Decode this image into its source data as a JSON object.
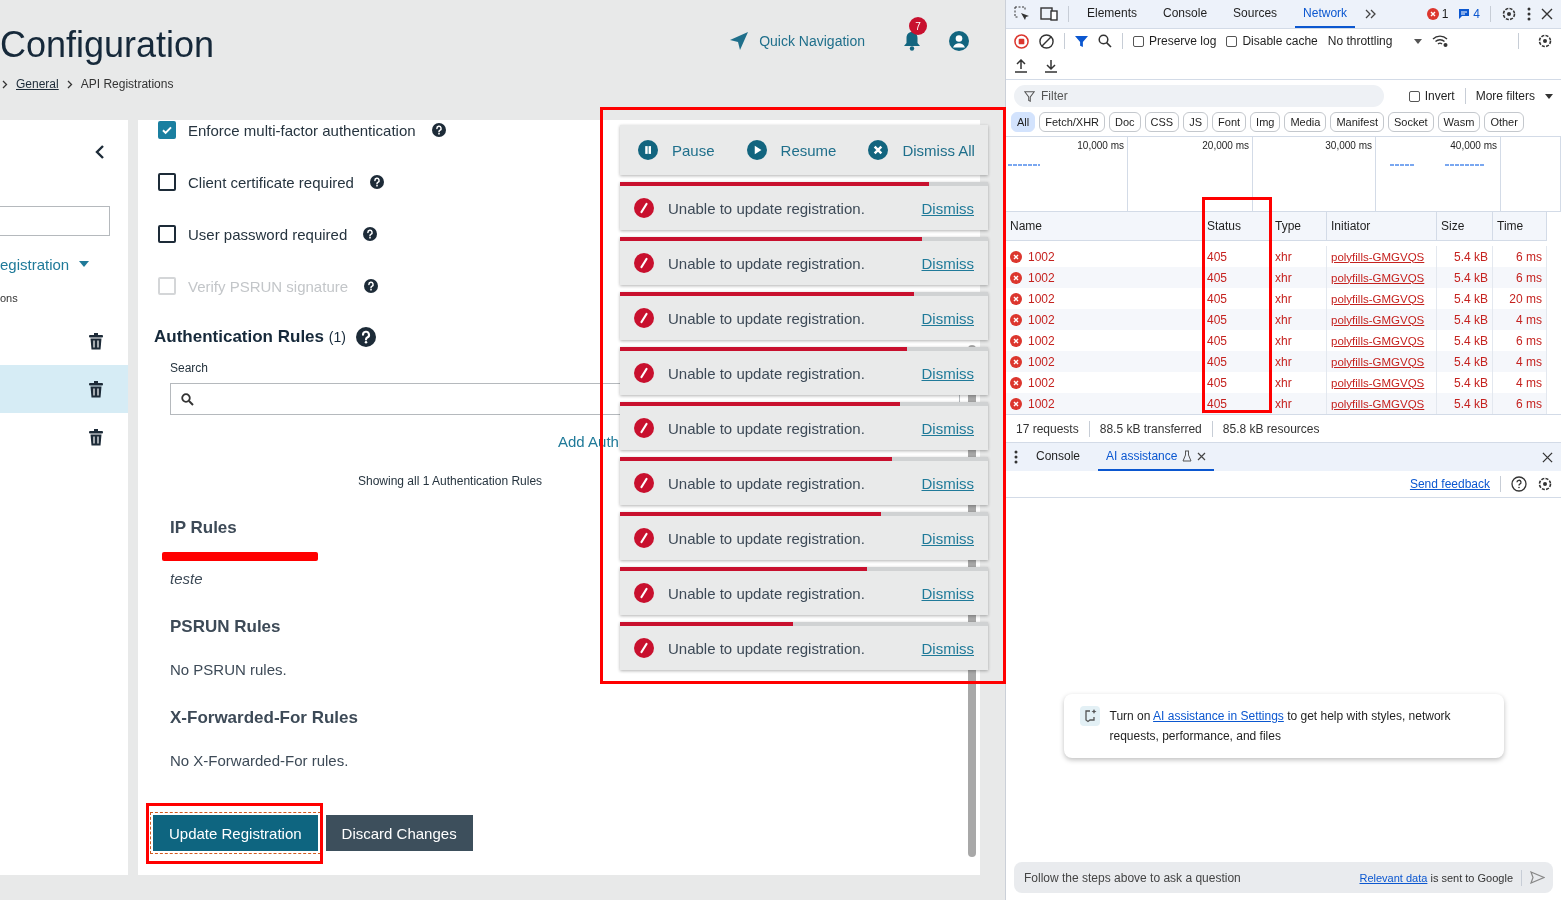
{
  "header": {
    "title": "Configuration",
    "breadcrumb": [
      {
        "label": "General",
        "link": true
      },
      {
        "label": "API Registrations",
        "link": false
      }
    ],
    "quick_nav": "Quick Navigation",
    "notifications": "7"
  },
  "sidebar": {
    "item_label": "egistration",
    "sub_label": "ons",
    "rows": [
      {
        "selected": false
      },
      {
        "selected": true
      },
      {
        "selected": false
      }
    ]
  },
  "form": {
    "options": [
      {
        "label": "Enforce multi-factor authentication",
        "checked": true,
        "disabled": false
      },
      {
        "label": "Client certificate required",
        "checked": false,
        "disabled": false
      },
      {
        "label": "User password required",
        "checked": false,
        "disabled": false
      },
      {
        "label": "Verify PSRUN signature",
        "checked": false,
        "disabled": true
      }
    ],
    "auth_rules": {
      "title": "Authentication Rules",
      "count": "(1)",
      "search_label": "Search",
      "add_link": "Add Auth",
      "showing": "Showing all 1 Authentication Rules"
    },
    "sections": [
      {
        "title": "IP Rules",
        "kind": "list",
        "items": [
          {
            "kind": "redacted"
          },
          {
            "kind": "text",
            "text": "teste"
          }
        ]
      },
      {
        "title": "PSRUN Rules",
        "kind": "empty",
        "text": "No PSRUN rules."
      },
      {
        "title": "X-Forwarded-For Rules",
        "kind": "empty",
        "text": "No X-Forwarded-For rules."
      }
    ],
    "buttons": [
      {
        "label": "Update Registration",
        "kind": "primary"
      },
      {
        "label": "Discard Changes",
        "kind": "secondary"
      }
    ]
  },
  "toasts": {
    "controls": [
      {
        "label": "Pause",
        "kind": "pause"
      },
      {
        "label": "Resume",
        "kind": "play"
      },
      {
        "label": "Dismiss All",
        "kind": "dismiss"
      }
    ],
    "items": [
      {
        "message": "Unable to update registration.",
        "action": "Dismiss",
        "level": 0.84
      },
      {
        "message": "Unable to update registration.",
        "action": "Dismiss",
        "level": 0.82
      },
      {
        "message": "Unable to update registration.",
        "action": "Dismiss",
        "level": 0.8
      },
      {
        "message": "Unable to update registration.",
        "action": "Dismiss",
        "level": 0.78
      },
      {
        "message": "Unable to update registration.",
        "action": "Dismiss",
        "level": 0.76
      },
      {
        "message": "Unable to update registration.",
        "action": "Dismiss",
        "level": 0.74
      },
      {
        "message": "Unable to update registration.",
        "action": "Dismiss",
        "level": 0.71
      },
      {
        "message": "Unable to update registration.",
        "action": "Dismiss",
        "level": 0.67
      },
      {
        "message": "Unable to update registration.",
        "action": "Dismiss",
        "level": 0.47
      }
    ]
  },
  "devtools": {
    "tabs": [
      {
        "label": "Elements",
        "selected": false
      },
      {
        "label": "Console",
        "selected": false
      },
      {
        "label": "Sources",
        "selected": false
      },
      {
        "label": "Network",
        "selected": true
      }
    ],
    "errors": "1",
    "messages": "4",
    "preserve_log": {
      "label": "Preserve log",
      "checked": false
    },
    "disable_cache": {
      "label": "Disable cache",
      "checked": false
    },
    "throttling": "No throttling",
    "filter": {
      "placeholder": "Filter"
    },
    "invert": {
      "label": "Invert",
      "checked": false
    },
    "more_filters": "More filters",
    "types": [
      {
        "label": "All",
        "selected": true
      },
      {
        "label": "Fetch/XHR",
        "selected": false
      },
      {
        "label": "Doc",
        "selected": false
      },
      {
        "label": "CSS",
        "selected": false
      },
      {
        "label": "JS",
        "selected": false
      },
      {
        "label": "Font",
        "selected": false
      },
      {
        "label": "Img",
        "selected": false
      },
      {
        "label": "Media",
        "selected": false
      },
      {
        "label": "Manifest",
        "selected": false
      },
      {
        "label": "Socket",
        "selected": false
      },
      {
        "label": "Wasm",
        "selected": false
      },
      {
        "label": "Other",
        "selected": false
      }
    ],
    "timeline": [
      "10,000 ms",
      "20,000 ms",
      "30,000 ms",
      "40,000 ms"
    ],
    "columns": [
      "Name",
      "Status",
      "Type",
      "Initiator",
      "Size",
      "Time"
    ],
    "rows": [
      {
        "name": "1002",
        "status": "405",
        "type": "xhr",
        "initiator": "polyfills-GMGVQS",
        "size": "5.4 kB",
        "time": "6 ms",
        "failed": true
      },
      {
        "name": "1002",
        "status": "405",
        "type": "xhr",
        "initiator": "polyfills-GMGVQS",
        "size": "5.4 kB",
        "time": "6 ms",
        "failed": true
      },
      {
        "name": "1002",
        "status": "405",
        "type": "xhr",
        "initiator": "polyfills-GMGVQS",
        "size": "5.4 kB",
        "time": "20 ms",
        "failed": true
      },
      {
        "name": "1002",
        "status": "405",
        "type": "xhr",
        "initiator": "polyfills-GMGVQS",
        "size": "5.4 kB",
        "time": "4 ms",
        "failed": true
      },
      {
        "name": "1002",
        "status": "405",
        "type": "xhr",
        "initiator": "polyfills-GMGVQS",
        "size": "5.4 kB",
        "time": "6 ms",
        "failed": true
      },
      {
        "name": "1002",
        "status": "405",
        "type": "xhr",
        "initiator": "polyfills-GMGVQS",
        "size": "5.4 kB",
        "time": "4 ms",
        "failed": true
      },
      {
        "name": "1002",
        "status": "405",
        "type": "xhr",
        "initiator": "polyfills-GMGVQS",
        "size": "5.4 kB",
        "time": "4 ms",
        "failed": true
      },
      {
        "name": "1002",
        "status": "405",
        "type": "xhr",
        "initiator": "polyfills-GMGVQS",
        "size": "5.4 kB",
        "time": "6 ms",
        "failed": true
      }
    ],
    "summary": [
      "17 requests",
      "88.5 kB transferred",
      "85.8 kB resources"
    ]
  },
  "drawer": {
    "tabs": [
      {
        "label": "Console",
        "selected": false,
        "closable": false
      },
      {
        "label": "AI assistance",
        "selected": true,
        "closable": true
      }
    ],
    "feedback": "Send feedback",
    "card": {
      "before": "Turn on ",
      "link": "AI assistance in Settings",
      "after": " to get help with styles, network requests, performance, and files"
    },
    "input": {
      "placeholder": "Follow the steps above to ask a question"
    },
    "notice": {
      "link": "Relevant data",
      "text": " is sent to Google"
    }
  }
}
